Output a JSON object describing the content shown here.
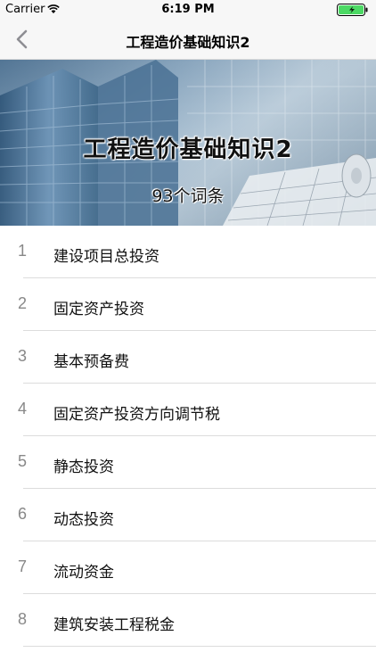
{
  "status_bar": {
    "carrier": "Carrier",
    "time": "6:19 PM"
  },
  "nav": {
    "title": "工程造价基础知识2",
    "back_icon": "chevron-left-icon"
  },
  "banner": {
    "title": "工程造价基础知识2",
    "subtitle": "93个词条"
  },
  "list": {
    "items": [
      {
        "index": "1",
        "label": "建设项目总投资"
      },
      {
        "index": "2",
        "label": "固定资产投资"
      },
      {
        "index": "3",
        "label": "基本预备费"
      },
      {
        "index": "4",
        "label": "固定资产投资方向调节税"
      },
      {
        "index": "5",
        "label": "静态投资"
      },
      {
        "index": "6",
        "label": "动态投资"
      },
      {
        "index": "7",
        "label": "流动资金"
      },
      {
        "index": "8",
        "label": "建筑安装工程税金"
      }
    ]
  },
  "colors": {
    "accent": "#8e8e93",
    "battery": "#4cd964"
  }
}
